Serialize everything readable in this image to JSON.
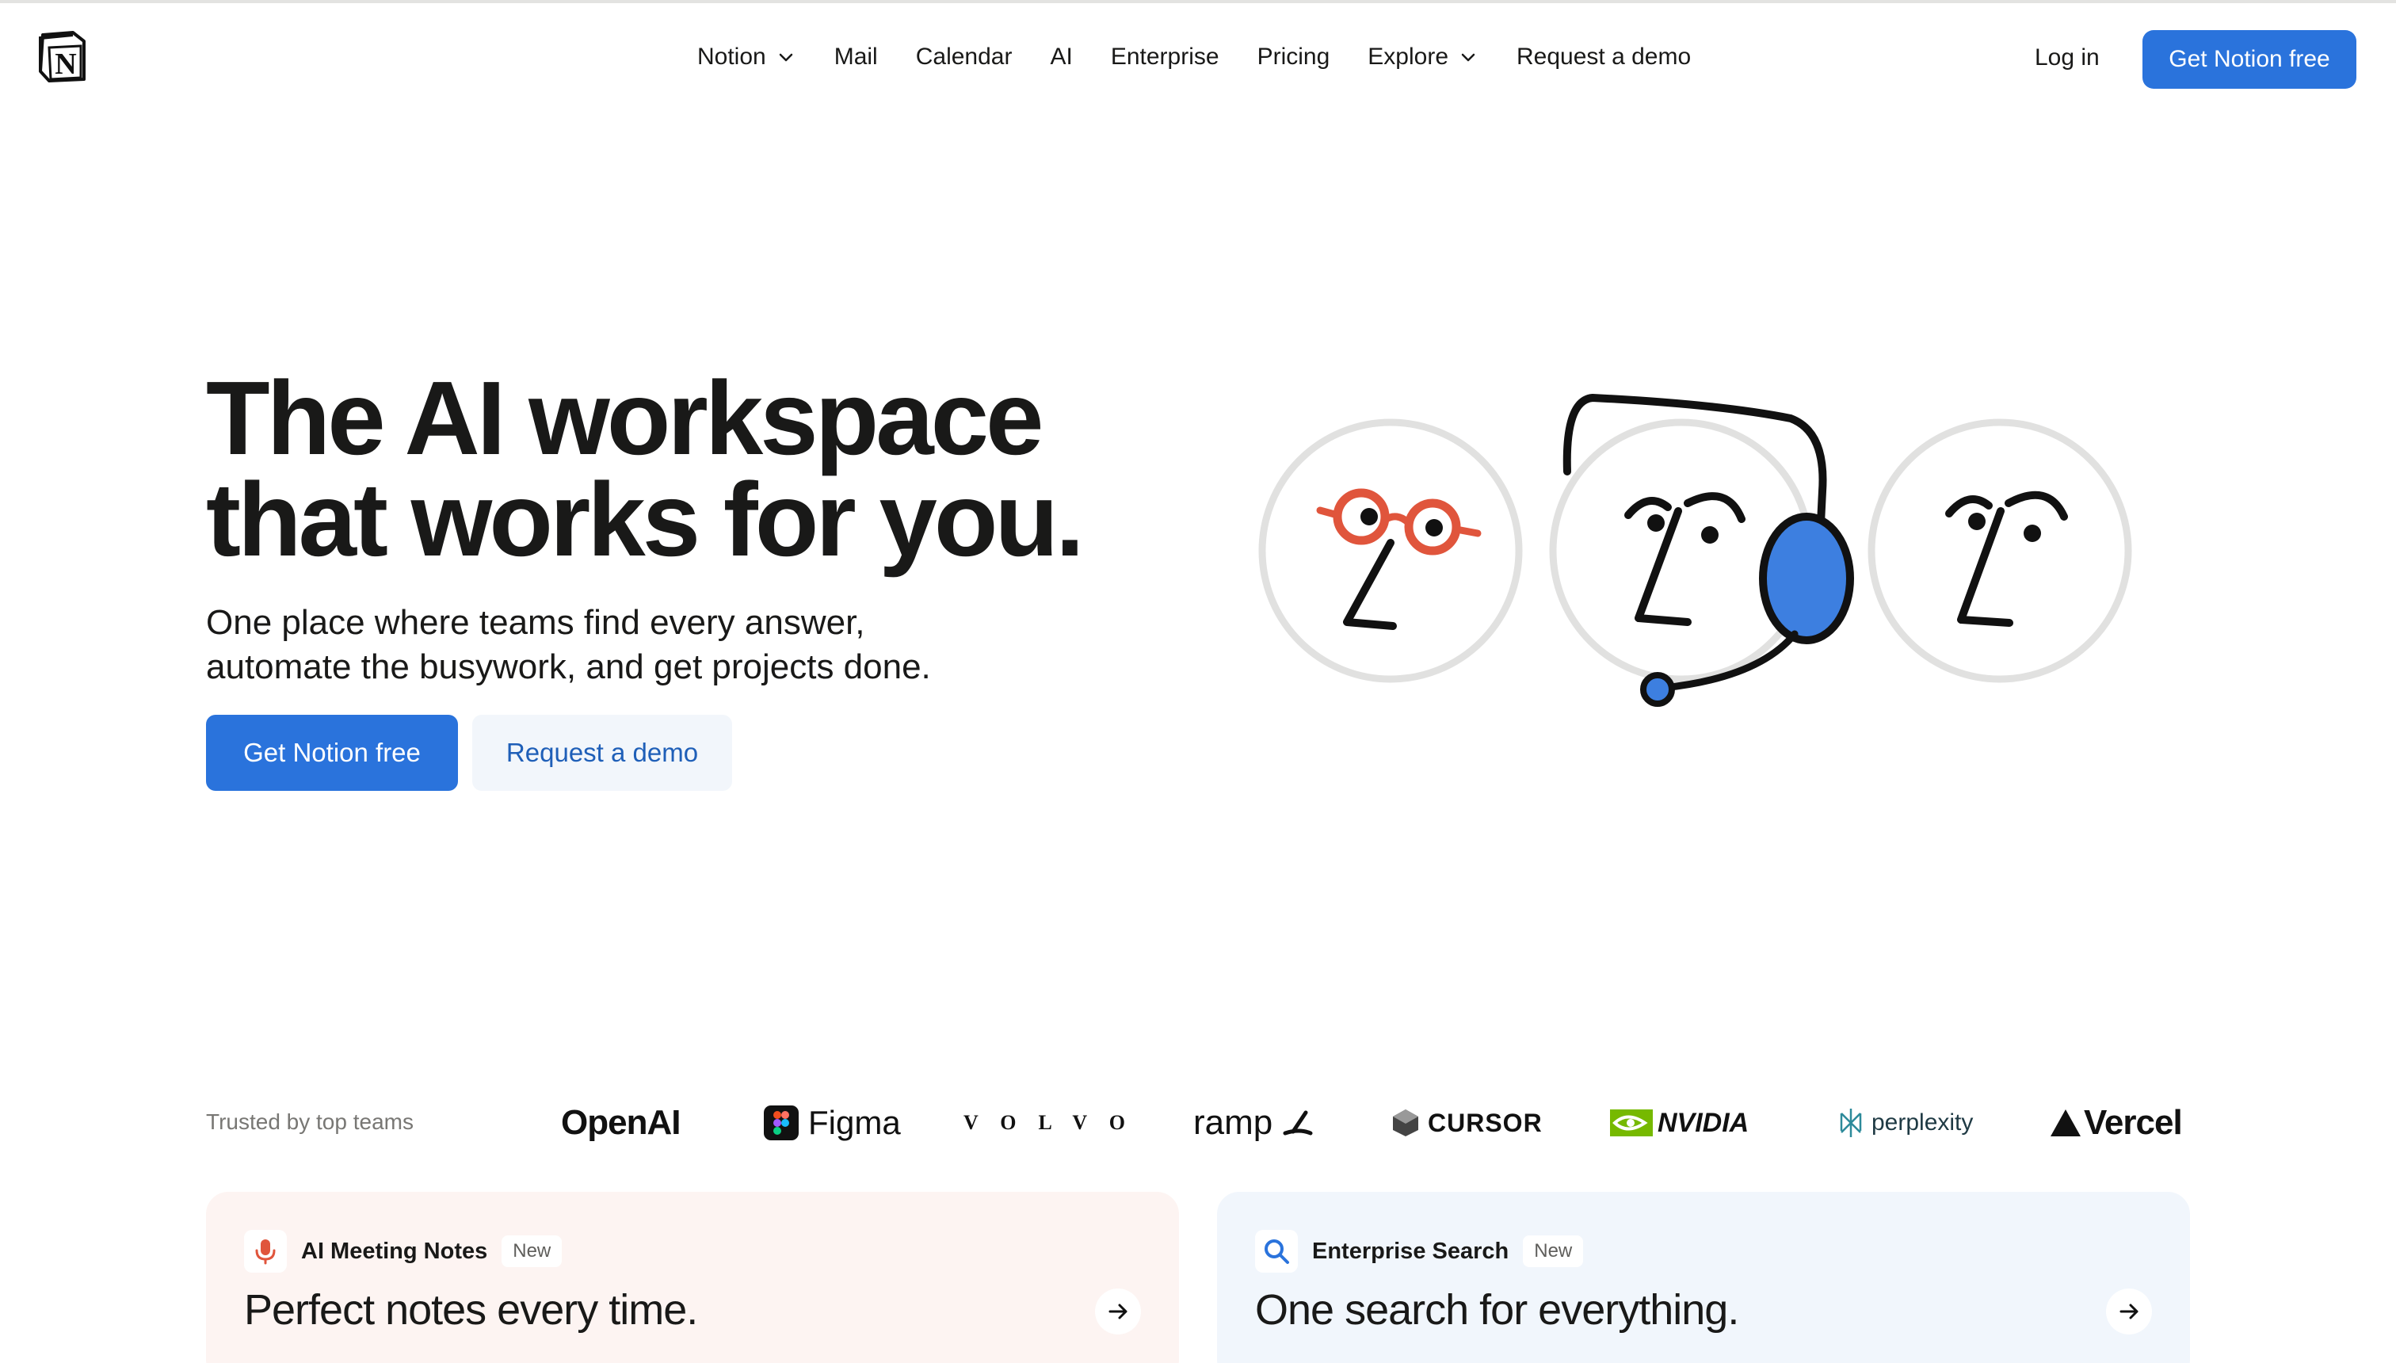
{
  "header": {
    "logo_name": "notion-logo",
    "nav": [
      {
        "label": "Notion",
        "dropdown": true
      },
      {
        "label": "Mail",
        "dropdown": false
      },
      {
        "label": "Calendar",
        "dropdown": false
      },
      {
        "label": "AI",
        "dropdown": false
      },
      {
        "label": "Enterprise",
        "dropdown": false
      },
      {
        "label": "Pricing",
        "dropdown": false
      },
      {
        "label": "Explore",
        "dropdown": true
      },
      {
        "label": "Request a demo",
        "dropdown": false
      }
    ],
    "login_label": "Log in",
    "cta_label": "Get Notion free"
  },
  "hero": {
    "title_line1": "The AI workspace",
    "title_line2": "that works for you.",
    "subtitle_line1": "One place where teams find every answer,",
    "subtitle_line2": "automate the busywork, and get projects done.",
    "primary_cta": "Get Notion free",
    "secondary_cta": "Request a demo"
  },
  "trusted": {
    "label": "Trusted by top teams",
    "logos": [
      "OpenAI",
      "Figma",
      "VOLVO",
      "ramp",
      "CURSOR",
      "NVIDIA",
      "perplexity",
      "Vercel"
    ]
  },
  "cards": [
    {
      "tag": "AI Meeting Notes",
      "badge": "New",
      "title": "Perfect notes every time.",
      "icon": "microphone-icon"
    },
    {
      "tag": "Enterprise Search",
      "badge": "New",
      "title": "One search for everything.",
      "icon": "search-icon"
    }
  ],
  "colors": {
    "accent": "#2a73dc",
    "text": "#191918",
    "muted": "#787774",
    "glasses": "#e0553c",
    "headset": "#3d7fe0"
  }
}
